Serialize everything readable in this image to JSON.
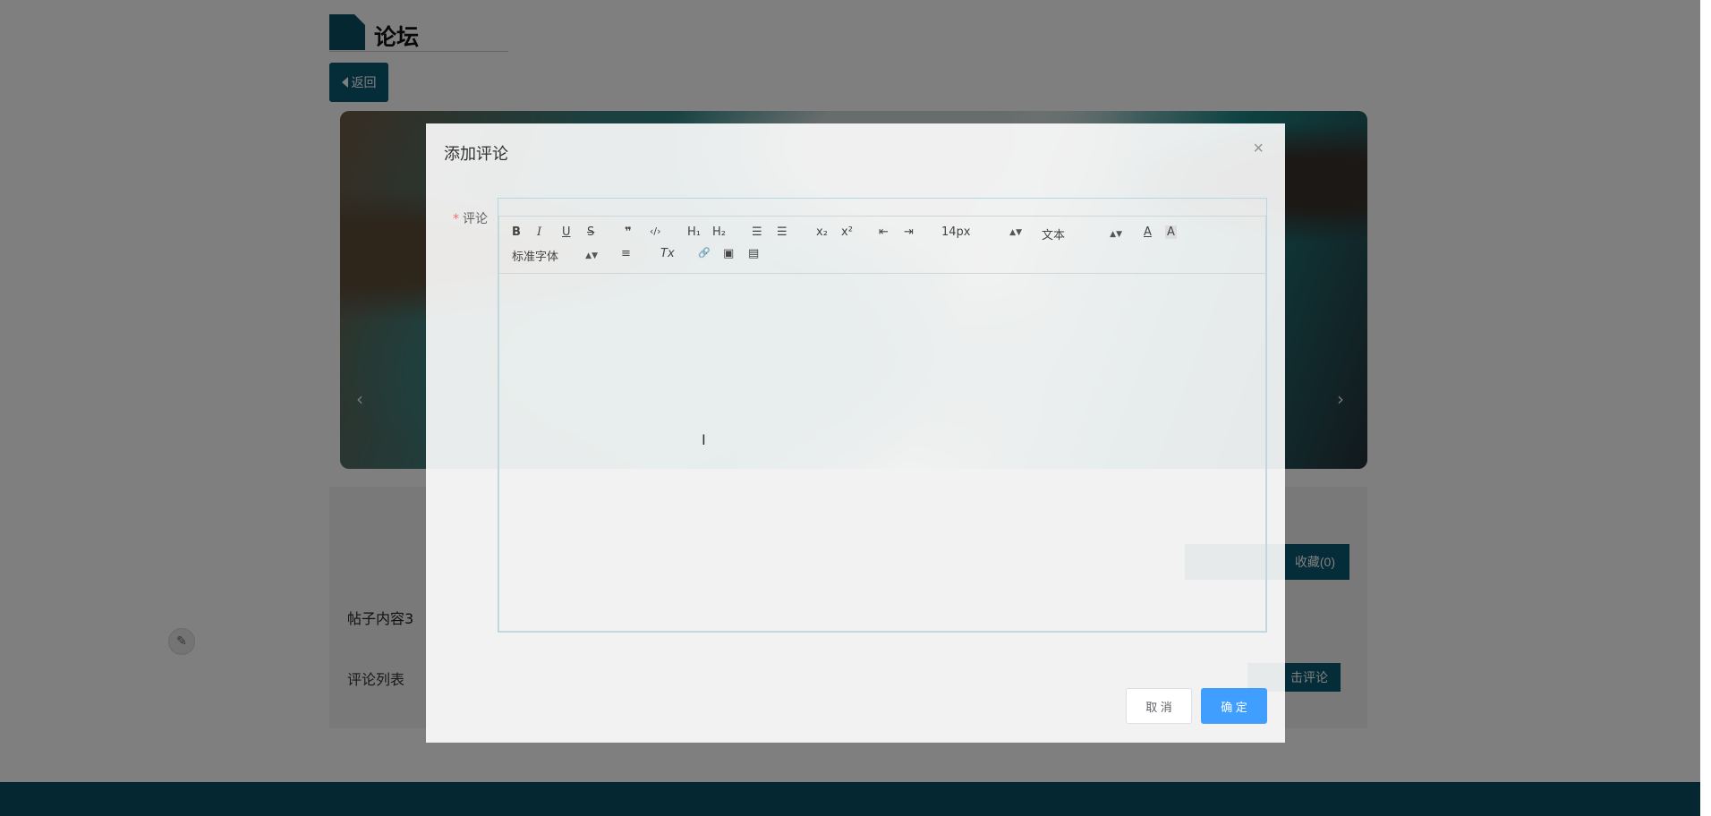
{
  "page": {
    "section_title": "论坛",
    "back_label": "返回",
    "post_content": "帖子内容3",
    "favorite_label": "收藏(0)",
    "comment_list_label": "评论列表",
    "comment_button_label": "击评论",
    "banner_prev": "‹",
    "banner_next": "›"
  },
  "dialog": {
    "title": "添加评论",
    "close_glyph": "×",
    "field_label": "评论",
    "required_mark": "*",
    "cancel_label": "取 消",
    "confirm_label": "确 定"
  },
  "toolbar": {
    "bold": "B",
    "italic": "I",
    "underline": "U",
    "strike": "S",
    "blockquote": "❞",
    "code": "‹/›",
    "h1": "H₁",
    "h2": "H₂",
    "ordered_list": "☰",
    "bullet_list": "☰",
    "subscript": "x₂",
    "superscript": "x²",
    "outdent": "⇤",
    "indent": "⇥",
    "font_size": "14px",
    "header_select": "文本",
    "font_color": "A",
    "bg_color": "A",
    "font_family": "标准字体",
    "align": "≡",
    "clean": "Tx",
    "link": "🔗",
    "image": "▣",
    "video": "▤"
  },
  "colors": {
    "brand": "#0b5a72",
    "primary": "#409eff"
  }
}
